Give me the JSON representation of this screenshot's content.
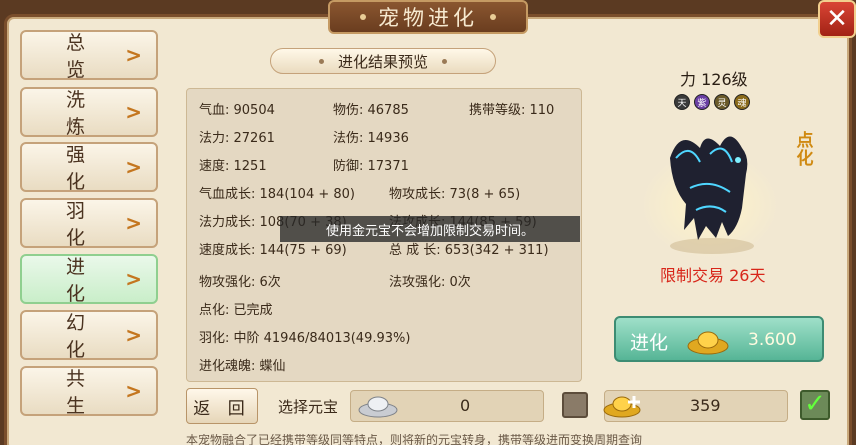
{
  "window": {
    "title": "宠物进化",
    "close_label": "✕"
  },
  "tabs": [
    {
      "label": "总 览",
      "chevron": ">",
      "active": false
    },
    {
      "label": "洗 炼",
      "chevron": ">",
      "active": false
    },
    {
      "label": "强 化",
      "chevron": ">",
      "active": false
    },
    {
      "label": "羽 化",
      "chevron": ">",
      "active": false
    },
    {
      "label": "进 化",
      "chevron": ">",
      "active": true
    },
    {
      "label": "幻 化",
      "chevron": ">",
      "active": false
    },
    {
      "label": "共 生",
      "chevron": ">",
      "active": false
    }
  ],
  "preview": {
    "title": "进化结果预览",
    "hp": "气血: 90504",
    "phys_atk": "物伤: 46785",
    "carry_level": "携带等级: 110",
    "mp": "法力: 27261",
    "mag_atk": "法伤: 14936",
    "speed": "速度: 1251",
    "defense": "防御: 17371",
    "hp_growth": "气血成长: 184(104 + 80)",
    "phys_growth": "物攻成长: 73(8 + 65)",
    "mp_growth": "法力成长: 108(70 + 38)",
    "mag_growth": "法攻成长: 144(85 + 59)",
    "speed_growth": "速度成长: 144(75 + 69)",
    "total_growth": "总 成 长: 653(342 + 311)",
    "phys_enhance": "物攻强化: 6次",
    "mag_enhance": "法攻强化: 0次",
    "dianhua": "点化: 已完成",
    "yuhua": "羽化: 中阶 41946/84013(49.93%)",
    "soul": "进化魂魄: 蝶仙"
  },
  "tooltip": "使用金元宝不会增加限制交易时间。",
  "pet": {
    "level": "力 126级",
    "dianhua_badge": "点化",
    "trade_limit": "限制交易 26天",
    "skill_icons": [
      "天",
      "紫",
      "灵",
      "魂"
    ]
  },
  "evolve_button": {
    "label": "进化",
    "cost": "3.600"
  },
  "bottom": {
    "back_label": "返 回",
    "select_label": "选择元宝",
    "silver_value": "0",
    "gold_value": "359",
    "note": "本宠物融合了已经携带等级同等特点，则将新的元宝转身，携带等级进而变换周期查询"
  },
  "colors": {
    "accent_green": "#56b596",
    "title_brown": "#6a3d1f",
    "trade_red": "#d8261a"
  }
}
